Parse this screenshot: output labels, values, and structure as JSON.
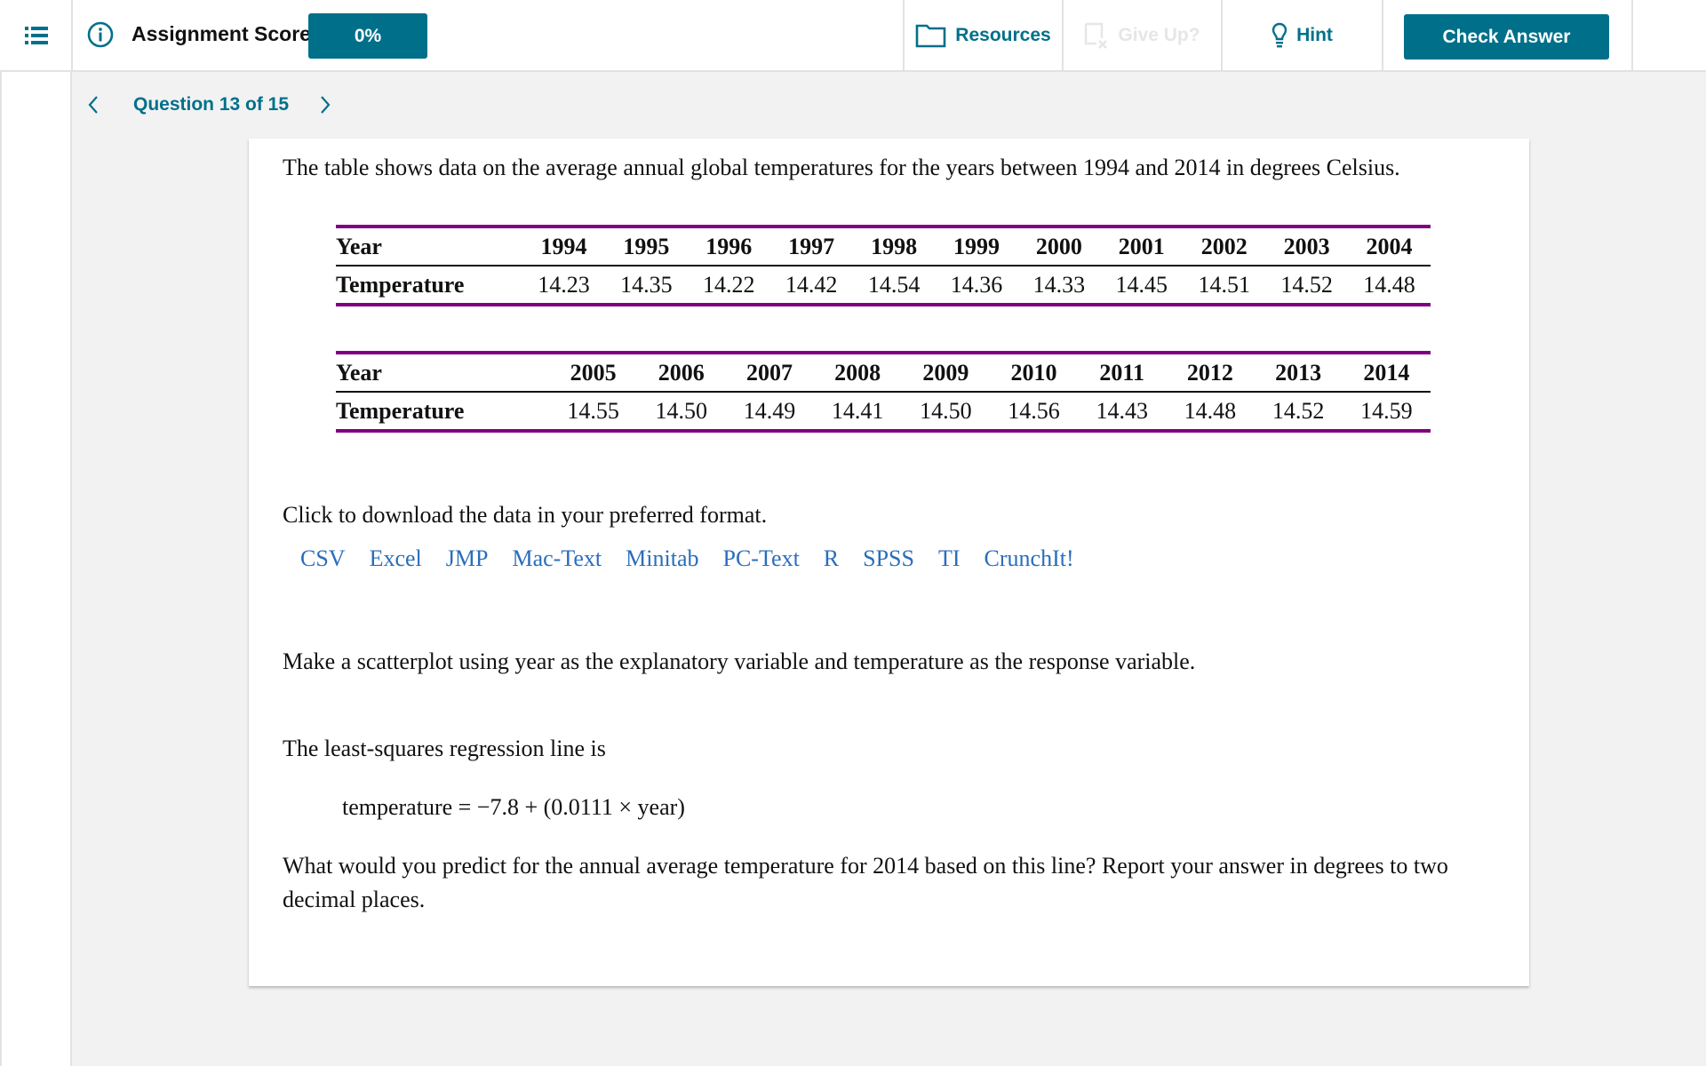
{
  "header": {
    "assignment_score_label": "Assignment Score:",
    "assignment_score_value": "0%",
    "resources_label": "Resources",
    "give_up_label": "Give Up?",
    "hint_label": "Hint",
    "check_answer_label": "Check Answer"
  },
  "question_nav": {
    "label": "Question 13 of 15"
  },
  "content": {
    "intro": "The table shows data on the average annual global temperatures for the years between 1994 and 2014 in degrees Celsius.",
    "table1": {
      "row_headers": [
        "Year",
        "Temperature"
      ],
      "years": [
        "1994",
        "1995",
        "1996",
        "1997",
        "1998",
        "1999",
        "2000",
        "2001",
        "2002",
        "2003",
        "2004"
      ],
      "temps": [
        "14.23",
        "14.35",
        "14.22",
        "14.42",
        "14.54",
        "14.36",
        "14.33",
        "14.45",
        "14.51",
        "14.52",
        "14.48"
      ]
    },
    "table2": {
      "row_headers": [
        "Year",
        "Temperature"
      ],
      "years": [
        "2005",
        "2006",
        "2007",
        "2008",
        "2009",
        "2010",
        "2011",
        "2012",
        "2013",
        "2014"
      ],
      "temps": [
        "14.55",
        "14.50",
        "14.49",
        "14.41",
        "14.50",
        "14.56",
        "14.43",
        "14.48",
        "14.52",
        "14.59"
      ]
    },
    "download_prompt": "Click to download the data in your preferred format.",
    "download_links": [
      "CSV",
      "Excel",
      "JMP",
      "Mac-Text",
      "Minitab",
      "PC-Text",
      "R",
      "SPSS",
      "TI",
      "CrunchIt!"
    ],
    "scatter_instruction": "Make a scatterplot using year as the explanatory variable and temperature as the response variable.",
    "regression_intro": "The least-squares regression line is",
    "regression_equation": "temperature = −7.8 + (0.0111 × year)",
    "question_line1": "What would you predict for the annual average temperature for 2014 based on this line? Report your answer in degrees to two",
    "question_line2": "decimal places."
  },
  "colors": {
    "brand_teal": "#00708a",
    "link_blue": "#2a6ebb",
    "table_rule_purple": "#800080"
  }
}
